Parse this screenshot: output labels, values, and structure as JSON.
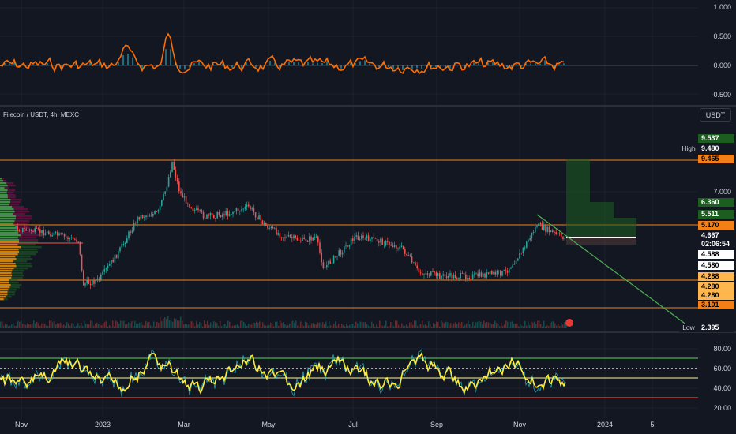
{
  "symbol_title": "Filecoin / USDT, 4h, MEXC",
  "currency_button": "USDT",
  "oscillator_axis": [
    "1.000",
    "0.500",
    "0.000",
    "-0.500"
  ],
  "price_axis": [
    "7.000"
  ],
  "rsi_axis": [
    "80.00",
    "60.00",
    "40.00",
    "20.00"
  ],
  "price_tags": [
    {
      "text": "9.537",
      "bg": "#1b5e20",
      "fg": "#ffffff"
    },
    {
      "text": "9.480",
      "bg": "#131722",
      "fg": "#ffffff",
      "side": "High"
    },
    {
      "text": "9.465",
      "bg": "#f57f17",
      "fg": "#000000"
    },
    {
      "text": "6.360",
      "bg": "#1b5e20",
      "fg": "#ffffff"
    },
    {
      "text": "5.511",
      "bg": "#1b5e20",
      "fg": "#ffffff"
    },
    {
      "text": "5.170",
      "bg": "#f57f17",
      "fg": "#000000"
    },
    {
      "text": "4.667",
      "bg": "#131722",
      "fg": "#ffffff"
    },
    {
      "text": "02:06:54",
      "bg": "#131722",
      "fg": "#ffffff"
    },
    {
      "text": "4.588",
      "bg": "#ffffff",
      "fg": "#000000"
    },
    {
      "text": "4.580",
      "bg": "#ffffff",
      "fg": "#000000"
    },
    {
      "text": "4.288",
      "bg": "#ffb74d",
      "fg": "#000000"
    },
    {
      "text": "4.280",
      "bg": "#ffb74d",
      "fg": "#000000"
    },
    {
      "text": "4.280",
      "bg": "#ffb74d",
      "fg": "#000000"
    },
    {
      "text": "3.101",
      "bg": "#f57f17",
      "fg": "#000000"
    },
    {
      "text": "2.395",
      "bg": "#131722",
      "fg": "#ffffff",
      "side": "Low"
    }
  ],
  "x_axis": [
    "Nov",
    "2023",
    "Mar",
    "May",
    "Jul",
    "Sep",
    "Nov",
    "2024",
    "5"
  ],
  "colors": {
    "background": "#131722",
    "grid": "#1e222d",
    "oscillator_line": "#ff6d00",
    "oscillator_hist": "#26c6da",
    "candle_up": "#26a69a",
    "candle_down": "#ef5350",
    "level_line": "#f57f17",
    "trend_line": "#4caf50",
    "rsi_line": "#ffeb3b",
    "rsi_fast": "#26c6da",
    "rsi_upper": "#4caf50",
    "rsi_lower": "#f44336",
    "target_box": "#1b5e20"
  }
}
